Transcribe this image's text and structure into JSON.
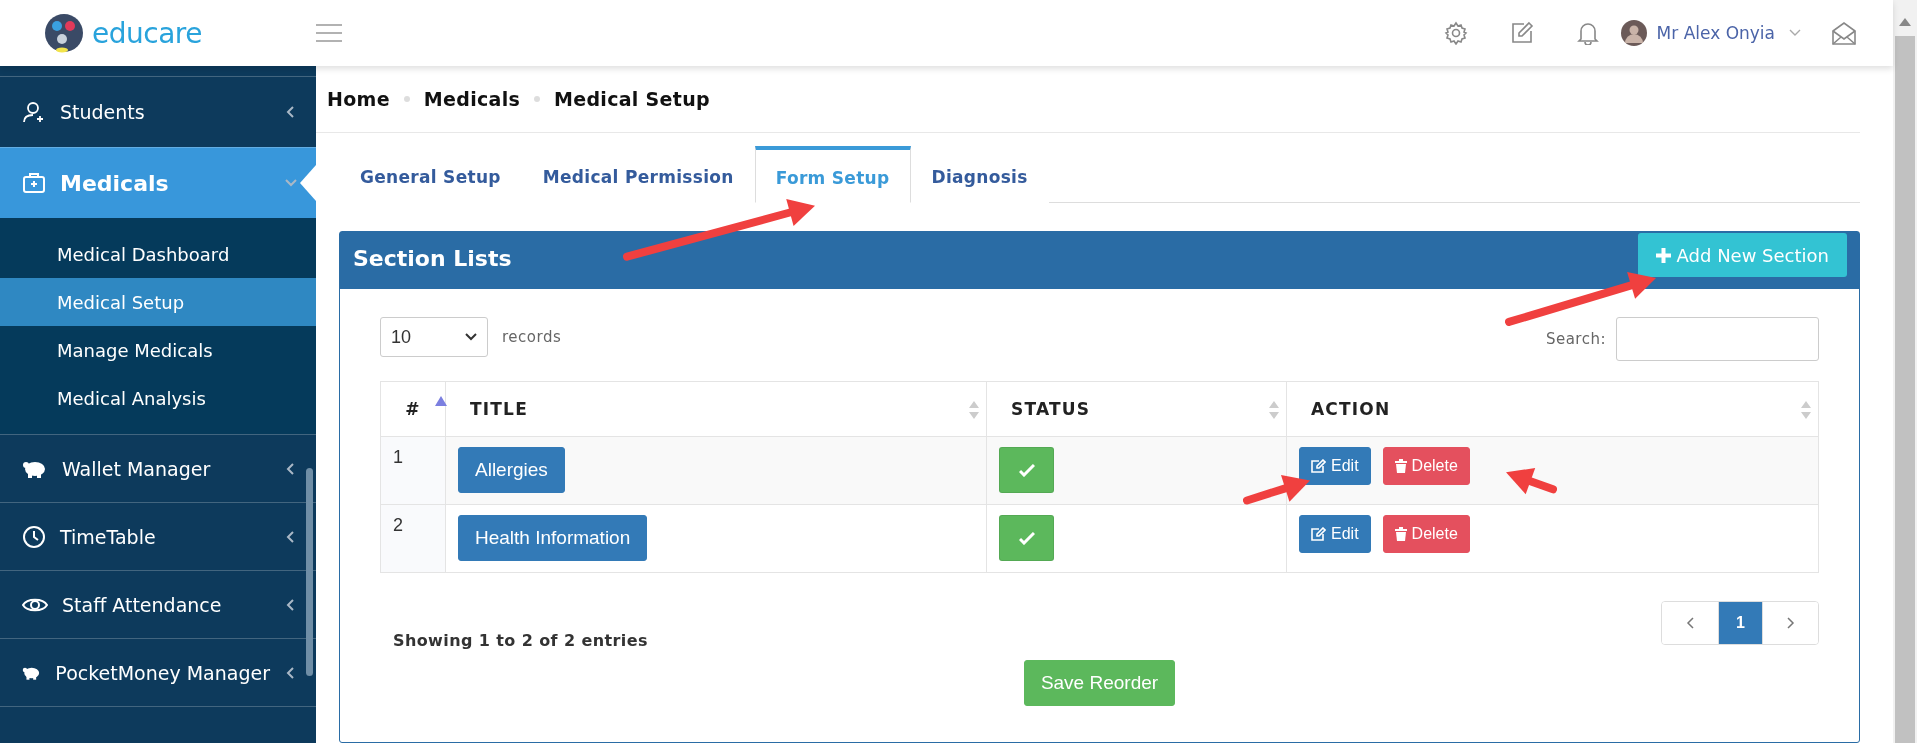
{
  "header": {
    "logo_text": "educare",
    "user_name": "Mr Alex Onyia"
  },
  "sidebar": {
    "items": [
      {
        "label": "Students",
        "selected": false,
        "expanded": false
      },
      {
        "label": "Medicals",
        "selected": true,
        "expanded": true,
        "children": [
          {
            "label": "Medical Dashboard",
            "selected": false
          },
          {
            "label": "Medical Setup",
            "selected": true
          },
          {
            "label": "Manage Medicals",
            "selected": false
          },
          {
            "label": "Medical Analysis",
            "selected": false
          }
        ]
      },
      {
        "label": "Wallet Manager",
        "selected": false,
        "expanded": false
      },
      {
        "label": "TimeTable",
        "selected": false,
        "expanded": false
      },
      {
        "label": "Staff Attendance",
        "selected": false,
        "expanded": false
      },
      {
        "label": "PocketMoney Manager",
        "selected": false,
        "expanded": false
      }
    ]
  },
  "breadcrumb": [
    "Home",
    "Medicals",
    "Medical Setup"
  ],
  "tabs": [
    {
      "label": "General Setup",
      "selected": false
    },
    {
      "label": "Medical Permission",
      "selected": false
    },
    {
      "label": "Form Setup",
      "selected": true
    },
    {
      "label": "Diagnosis",
      "selected": false
    }
  ],
  "panel": {
    "title": "Section Lists",
    "add_button": "Add New Section",
    "length_select": {
      "value": "10"
    },
    "records_label": "records",
    "search_label": "Search:",
    "table": {
      "columns": [
        {
          "label": "#",
          "sorted": true
        },
        {
          "label": "TITLE",
          "sorted": false
        },
        {
          "label": "STATUS",
          "sorted": false
        },
        {
          "label": "ACTION",
          "sorted": false
        }
      ],
      "rows": [
        {
          "number": "1",
          "title": "Allergies",
          "active": true,
          "edit": "Edit",
          "delete": "Delete"
        },
        {
          "number": "2",
          "title": "Health Information",
          "active": true,
          "edit": "Edit",
          "delete": "Delete"
        }
      ]
    },
    "info": "Showing 1 to 2 of 2 entries",
    "pages": [
      {
        "label": "1",
        "selected": true
      }
    ],
    "save_button": "Save Reorder"
  }
}
